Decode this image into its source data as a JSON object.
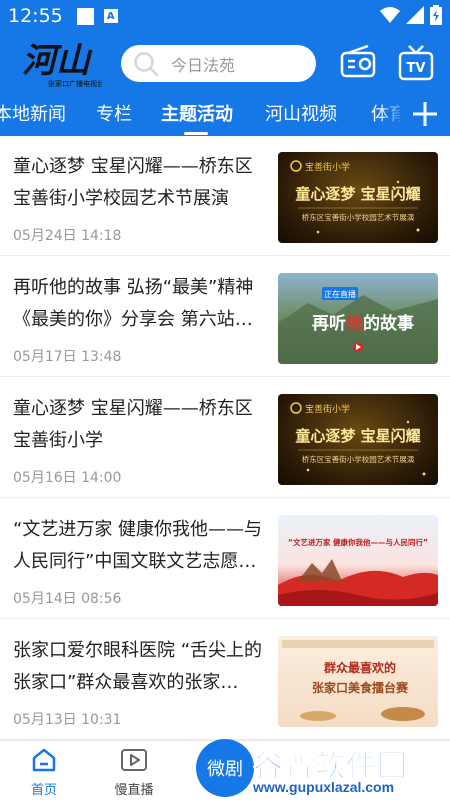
{
  "status_bar": {
    "time": "12:55",
    "a_glyph": "A"
  },
  "header": {
    "logo_text": "河山",
    "logo_caption": "张家口广播电视台",
    "search_placeholder": "今日法苑"
  },
  "tabs": [
    {
      "label": "本地新闻"
    },
    {
      "label": "专栏"
    },
    {
      "label": "主题活动",
      "active": true
    },
    {
      "label": "河山视频"
    },
    {
      "label": "体育"
    }
  ],
  "news": [
    {
      "title": "童心逐梦 宝星闪耀——桥东区宝善街小学校园艺术节展演",
      "time": "05月24日 14:18",
      "thumb": {
        "school": "宝善街小学",
        "headline": "童心逐梦 宝星闪耀",
        "caption": "桥东区宝善街小学校园艺术节展演"
      }
    },
    {
      "title": "再听他的故事 弘扬“最美”精神《最美的你》分享会 第六站…",
      "time": "05月17日 13:48",
      "thumb": {
        "badge": "正在直播",
        "headline_a": "再听",
        "headline_b": "他",
        "headline_c": "的故事"
      }
    },
    {
      "title": "童心逐梦 宝星闪耀——桥东区宝善街小学",
      "time": "05月16日 14:00",
      "thumb": {
        "school": "宝善街小学",
        "headline": "童心逐梦 宝星闪耀",
        "caption": "桥东区宝善街小学校园艺术节展演"
      }
    },
    {
      "title": "“文艺进万家 健康你我他——与人民同行”中国文联文艺志愿…",
      "time": "05月14日 08:56",
      "thumb": {
        "headline": "“文艺进万家 健康你我他——与人民同行”"
      }
    },
    {
      "title": "张家口爱尔眼科医院 “舌尖上的张家口”群众最喜欢的张家…",
      "time": "05月13日 10:31",
      "thumb": {
        "line1": "群众最喜欢的",
        "line2": "张家口美食擂台赛"
      }
    }
  ],
  "bottom_nav": {
    "home": "首页",
    "live": "慢直播",
    "center": "微剧"
  },
  "watermark": {
    "text": "谷普软件园",
    "url": "www.gupuxlazal.com"
  },
  "colors": {
    "brand": "#1677e6",
    "thumb_gold": "#f2c94c",
    "thumb_red": "#c3201f"
  }
}
